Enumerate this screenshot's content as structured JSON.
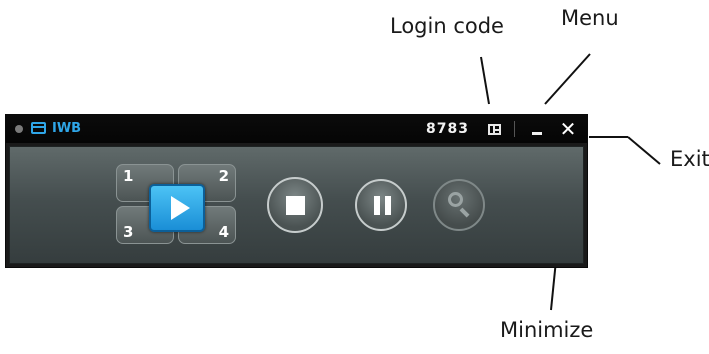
{
  "callouts": {
    "login_code": "Login code",
    "menu": "Menu",
    "exit": "Exit",
    "minimize": "Minimize"
  },
  "titlebar": {
    "app_title": "IWB",
    "login_code": "8783",
    "exit_glyph": "✕",
    "icons": [
      "status-dot",
      "window-icon",
      "menu-icon",
      "minimize-icon",
      "close-icon"
    ]
  },
  "controls": {
    "screens": [
      "1",
      "2",
      "3",
      "4"
    ],
    "buttons": [
      "play",
      "stop",
      "pause",
      "zoom"
    ]
  },
  "colors": {
    "accent": "#2fa6e8",
    "titlebar_bg": "#050505",
    "body_bg": "#4a5353"
  }
}
